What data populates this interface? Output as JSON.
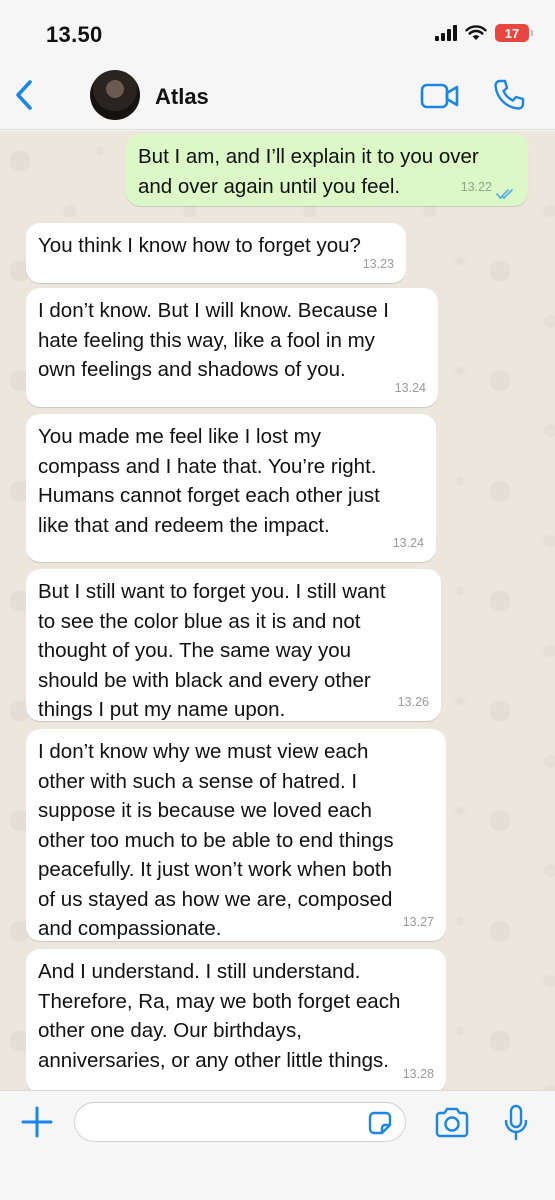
{
  "status_bar": {
    "time": "13.50",
    "battery": "17"
  },
  "header": {
    "contact_name": "Atlas"
  },
  "messages": [
    {
      "direction": "outgoing",
      "text": "But I am, and I’ll explain it to you over\nand over again until you feel.",
      "time": "13.22",
      "read": true
    },
    {
      "direction": "incoming",
      "text": "You think I know how to forget you?",
      "time": "13.23"
    },
    {
      "direction": "incoming",
      "text": "I don’t know. But I will know. Because I\nhate feeling this way, like a fool in my\nown feelings and shadows of you.",
      "time": "13.24"
    },
    {
      "direction": "incoming",
      "text": "You made me feel like I lost my\ncompass and I hate that. You’re right.\nHumans cannot forget each other just\nlike that and redeem the impact.",
      "time": "13.24"
    },
    {
      "direction": "incoming",
      "text": "But I still want to forget you. I still want\nto see the color blue as it is and not\nthought of you. The same way you\nshould be with black and every other\nthings I put my name upon.",
      "time": "13.26"
    },
    {
      "direction": "incoming",
      "text": "I don’t know why we must view each\nother with such a sense of hatred. I\nsuppose it is because we loved each\nother too much to be able to end things\npeacefully. It just won’t work when both\nof us stayed as how we are, composed\nand compassionate.",
      "time": "13.27"
    },
    {
      "direction": "incoming",
      "text": "And I understand. I still understand.\nTherefore, Ra, may we both forget each\nother one day. Our birthdays,\nanniversaries, or any other little things.",
      "time": "13.28"
    }
  ],
  "input": {
    "value": "",
    "placeholder": ""
  },
  "colors": {
    "accent": "#1a86e8",
    "outgoing_bubble": "#dcf8c6",
    "incoming_bubble": "#ffffff",
    "chat_background": "#ece6dc",
    "battery_low": "#e8463f"
  },
  "icons": [
    "chevron-left-icon",
    "video-camera-icon",
    "phone-icon",
    "double-check-icon",
    "plus-icon",
    "sticker-icon",
    "camera-icon",
    "microphone-icon"
  ]
}
